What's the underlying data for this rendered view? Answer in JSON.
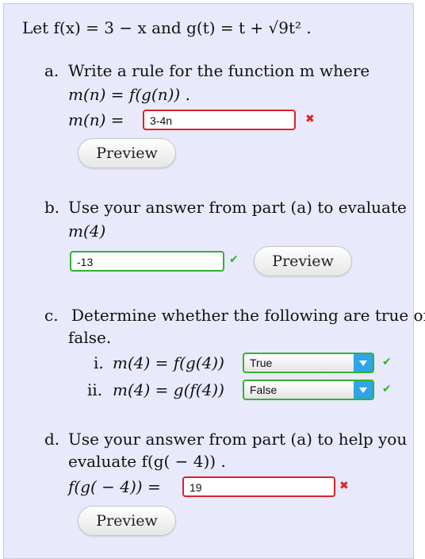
{
  "intro": {
    "text": "Let f(x) = 3 − x and g(t) = t + √9t² ."
  },
  "part_a": {
    "label": "a.",
    "prompt_1": "Write a rule for the function m where",
    "prompt_2": "m(n) = f(g(n)) .",
    "answer_label": "m(n) =",
    "answer_value": "3-4n",
    "status": "incorrect",
    "preview_label": "Preview"
  },
  "part_b": {
    "label": "b.",
    "prompt_1": "Use your answer from part (a) to evaluate",
    "prompt_2": "m(4)",
    "answer_value": "-13",
    "status": "correct",
    "preview_label": "Preview"
  },
  "part_c": {
    "label": "c.",
    "prompt_1": "Determine whether the following are true or",
    "prompt_2": "false.",
    "items": [
      {
        "roman": "i.",
        "expr": "m(4) = f(g(4))",
        "selected": "True",
        "status": "correct"
      },
      {
        "roman": "ii.",
        "expr": "m(4) = g(f(4))",
        "selected": "False",
        "status": "correct"
      }
    ]
  },
  "part_d": {
    "label": "d.",
    "prompt_1": "Use your answer from part (a) to help you",
    "prompt_2": "evaluate f(g( − 4)) .",
    "answer_label": "f(g( − 4)) =",
    "answer_value": "19",
    "status": "incorrect",
    "preview_label": "Preview"
  },
  "icons": {
    "incorrect": "x-mark-icon",
    "correct": "check-mark-icon"
  },
  "colors": {
    "panel_bg": "#e8e9fb",
    "error": "#d9232a",
    "success": "#35b233",
    "dropdown_accent": "#2fa4e7"
  }
}
